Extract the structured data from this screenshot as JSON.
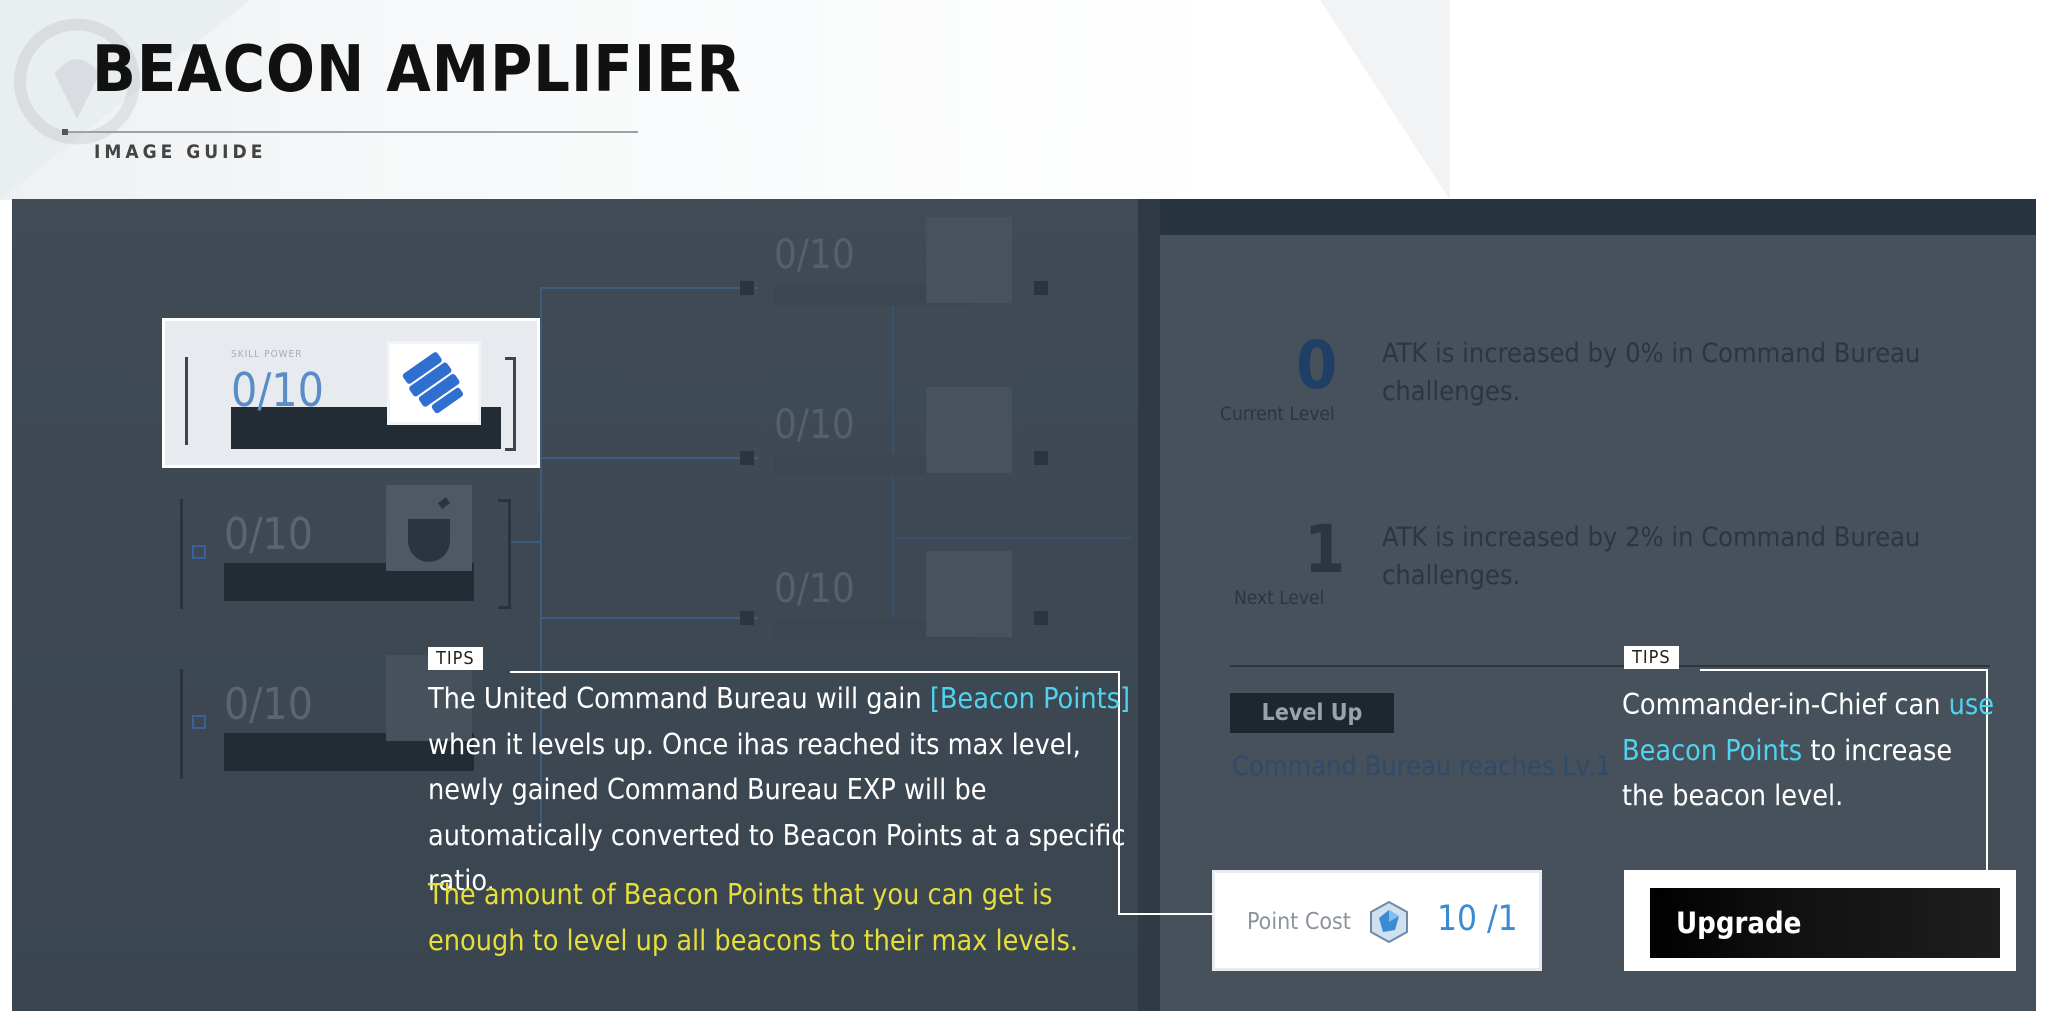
{
  "header": {
    "title": "BEACON AMPLIFIER",
    "subtitle": "IMAGE GUIDE"
  },
  "beacons": {
    "selected": {
      "label": "SKILL POWER",
      "progress": "0/10",
      "icon": "fist-icon"
    },
    "left_2": {
      "progress": "0/10",
      "icon": "pot-icon"
    },
    "left_3": {
      "progress": "0/10",
      "icon": "feather-icon"
    },
    "mid_1": {
      "progress": "0/10",
      "icon": "flame-icon"
    },
    "mid_2": {
      "progress": "0/10",
      "icon": "snowflake-icon"
    },
    "mid_3": {
      "progress": "0/10",
      "icon": "lightning-icon"
    }
  },
  "details": {
    "current_level_value": "0",
    "current_level_caption": "Current Level",
    "current_level_desc": "ATK is increased by 0% in Command Bureau challenges.",
    "next_level_value": "1",
    "next_level_caption": "Next Level",
    "next_level_desc": "ATK is increased by 2% in Command Bureau challenges.",
    "level_up_badge": "Level Up",
    "level_up_requirement": "Command Bureau reaches Lv.1"
  },
  "cost": {
    "label": "Point Cost",
    "value": "10 /1",
    "icon": "beacon-gem-icon"
  },
  "upgrade_button": "Upgrade",
  "tips": [
    {
      "label": "TIPS",
      "text_1": "The United Command Bureau will gain ",
      "highlight": "[Beacon Points]",
      "text_2": " when it levels up. Once ihas reached its max level, newly gained Command Bureau EXP will be automatically converted to Beacon Points at a specific ratio.",
      "note": "The amount of Beacon Points that you can get is enough to level up all beacons to their max levels."
    },
    {
      "label": "TIPS",
      "text_1": "Commander-in-Chief can ",
      "highlight": "use Beacon Points",
      "text_2": " to increase the beacon level."
    }
  ],
  "colors": {
    "cyan_highlight": "#4fd3ef",
    "yellow_note": "#e6de3a",
    "level_blue": "#1f3f66",
    "cost_blue": "#3a8ad4"
  }
}
